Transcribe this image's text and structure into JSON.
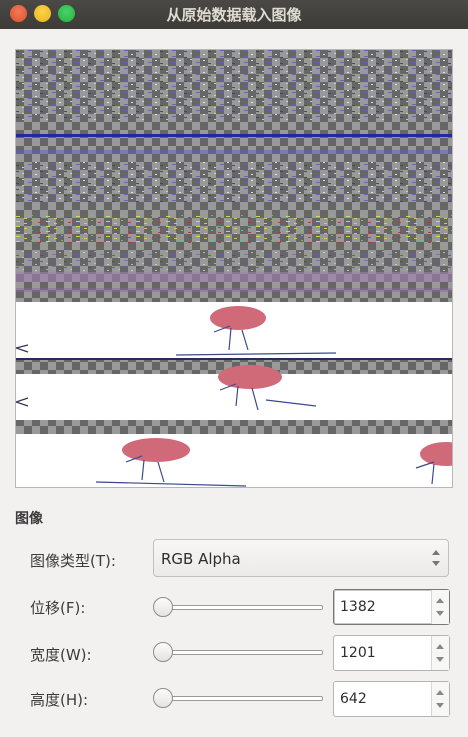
{
  "window": {
    "title": "从原始数据载入图像"
  },
  "section": {
    "title": "图像"
  },
  "fields": {
    "image_type": {
      "label": "图像类型(T):",
      "value": "RGB Alpha"
    },
    "offset": {
      "label": "位移(F):",
      "value": "1382"
    },
    "width": {
      "label": "宽度(W):",
      "value": "1201"
    },
    "height": {
      "label": "高度(H):",
      "value": "642"
    }
  }
}
